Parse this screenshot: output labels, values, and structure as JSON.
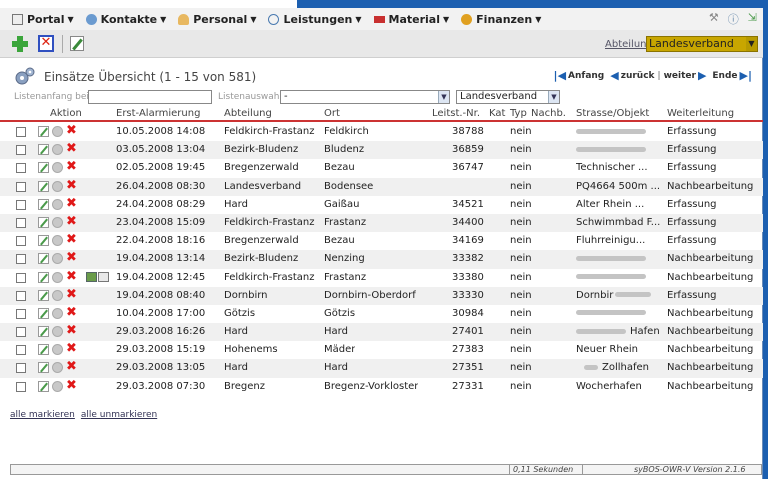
{
  "menu": {
    "items": [
      {
        "label": "Portal",
        "icon": "portal-icon"
      },
      {
        "label": "Kontakte",
        "icon": "contacts-icon"
      },
      {
        "label": "Personal",
        "icon": "person-icon"
      },
      {
        "label": "Leistungen",
        "icon": "services-icon"
      },
      {
        "label": "Material",
        "icon": "truck-icon"
      },
      {
        "label": "Finanzen",
        "icon": "finance-icon"
      }
    ],
    "right_icons": [
      "tools-icon",
      "help-icon",
      "logout-icon"
    ]
  },
  "toolbar": {
    "abteilung_label": "Abteilung",
    "abteilung_value": "Landesverband"
  },
  "page": {
    "title": "Einsätze Übersicht (1 - 15 von 581)"
  },
  "pager": {
    "first": "Anfang",
    "prev": "zurück",
    "next": "weiter",
    "last": "Ende"
  },
  "filter": {
    "start_label": "Listenanfang bei:",
    "start_value": "",
    "list_label": "Listenauswahl:",
    "list_value": "-",
    "department_value": "Landesverband"
  },
  "table": {
    "headers": [
      "Aktion",
      "Erst-Alarmierung",
      "Abteilung",
      "Ort",
      "Leitst.-Nr.",
      "Kat",
      "Typ",
      "Nachb.",
      "Strasse/Objekt",
      "Weiterleitung"
    ],
    "rows": [
      {
        "date": "10.05.2008 14:08",
        "abteilung": "Feldkirch-Frastanz",
        "ort": "Feldkirch",
        "nr": "38788",
        "nachb": "nein",
        "strasse": "",
        "weiter": "Erfassung"
      },
      {
        "date": "03.05.2008 13:04",
        "abteilung": "Bezirk-Bludenz",
        "ort": "Bludenz",
        "nr": "36859",
        "nachb": "nein",
        "strasse": "",
        "weiter": "Erfassung"
      },
      {
        "date": "02.05.2008 19:45",
        "abteilung": "Bregenzerwald",
        "ort": "Bezau",
        "nr": "36747",
        "nachb": "nein",
        "strasse": "Technischer ...",
        "weiter": "Erfassung"
      },
      {
        "date": "26.04.2008 08:30",
        "abteilung": "Landesverband",
        "ort": "Bodensee",
        "nr": "",
        "nachb": "nein",
        "strasse": "PQ4664 500m ...",
        "weiter": "Nachbearbeitung"
      },
      {
        "date": "24.04.2008 08:29",
        "abteilung": "Hard",
        "ort": "Gaißau",
        "nr": "34521",
        "nachb": "nein",
        "strasse": "Alter Rhein ...",
        "weiter": "Erfassung"
      },
      {
        "date": "23.04.2008 15:09",
        "abteilung": "Feldkirch-Frastanz",
        "ort": "Frastanz",
        "nr": "34400",
        "nachb": "nein",
        "strasse": "Schwimmbad F...",
        "weiter": "Erfassung"
      },
      {
        "date": "22.04.2008 18:16",
        "abteilung": "Bregenzerwald",
        "ort": "Bezau",
        "nr": "34169",
        "nachb": "nein",
        "strasse": "Fluhrreinigu...",
        "weiter": "Erfassung"
      },
      {
        "date": "19.04.2008 13:14",
        "abteilung": "Bezirk-Bludenz",
        "ort": "Nenzing",
        "nr": "33382",
        "nachb": "nein",
        "strasse": "",
        "weiter": "Nachbearbeitung"
      },
      {
        "date": "19.04.2008 12:45",
        "abteilung": "Feldkirch-Frastanz",
        "ort": "Frastanz",
        "nr": "33380",
        "nachb": "nein",
        "strasse": "",
        "weiter": "Nachbearbeitung",
        "extra": true
      },
      {
        "date": "19.04.2008 08:40",
        "abteilung": "Dornbirn",
        "ort": "Dornbirn-Oberdorf",
        "nr": "33330",
        "nachb": "nein",
        "strasse": "Dornbir",
        "weiter": "Erfassung"
      },
      {
        "date": "10.04.2008 17:00",
        "abteilung": "Götzis",
        "ort": "Götzis",
        "nr": "30984",
        "nachb": "nein",
        "strasse": "",
        "weiter": "Nachbearbeitung"
      },
      {
        "date": "29.03.2008 16:26",
        "abteilung": "Hard",
        "ort": "Hard",
        "nr": "27401",
        "nachb": "nein",
        "strasse": "Hafen",
        "weiter": "Nachbearbeitung"
      },
      {
        "date": "29.03.2008 15:19",
        "abteilung": "Hohenems",
        "ort": "Mäder",
        "nr": "27383",
        "nachb": "nein",
        "strasse": "Neuer Rhein",
        "weiter": "Nachbearbeitung"
      },
      {
        "date": "29.03.2008 13:05",
        "abteilung": "Hard",
        "ort": "Hard",
        "nr": "27351",
        "nachb": "nein",
        "strasse": "Zollhafen",
        "weiter": "Nachbearbeitung"
      },
      {
        "date": "29.03.2008 07:30",
        "abteilung": "Bregenz",
        "ort": "Bregenz-Vorkloster",
        "nr": "27331",
        "nachb": "nein",
        "strasse": "Wocherhafen",
        "weiter": "Nachbearbeitung"
      }
    ]
  },
  "links": {
    "mark_all": "alle markieren",
    "unmark_all": "alle unmarkieren"
  },
  "status": {
    "time": "0,11 Sekunden",
    "version": "syBOS-OWR-V Version 2.1.6"
  },
  "colors": {
    "accent_blue": "#1c5fb0",
    "select_gold": "#c8a600",
    "delete_red": "#e01818",
    "header_line": "#cc3333"
  }
}
